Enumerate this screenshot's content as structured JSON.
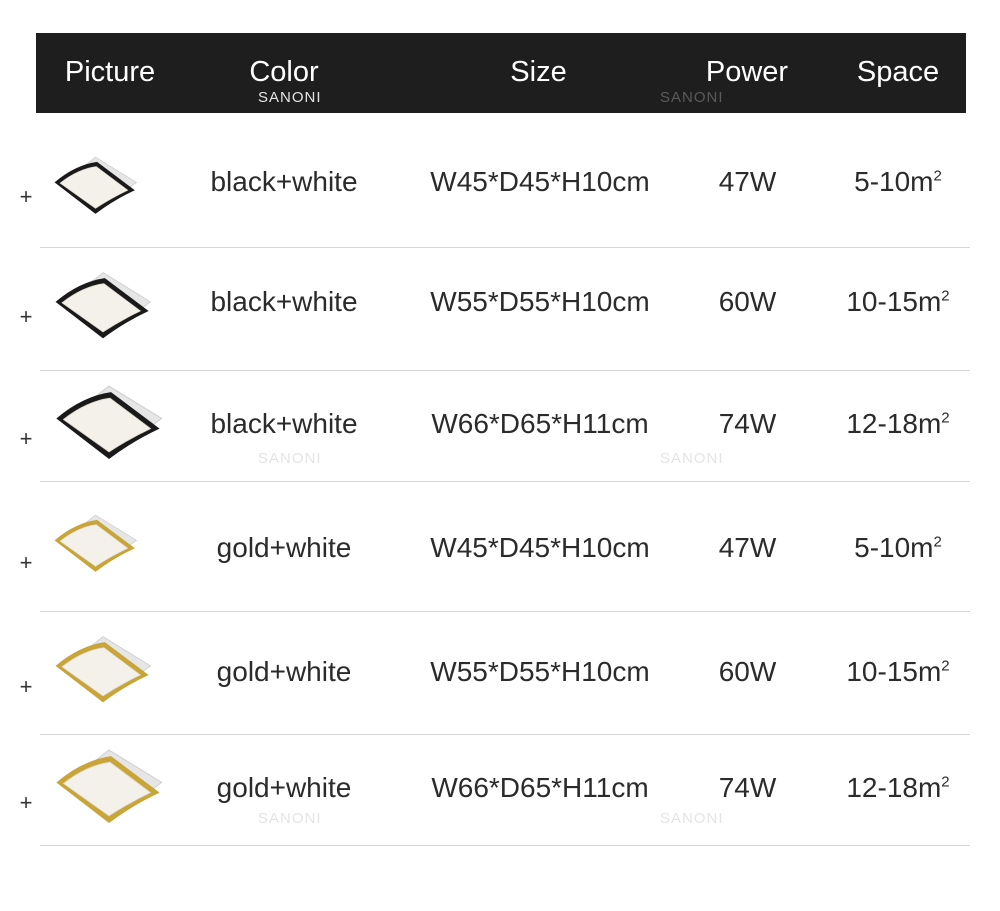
{
  "header": {
    "picture": "Picture",
    "color": "Color",
    "size": "Size",
    "power": "Power",
    "space": "Space"
  },
  "watermark": "SANONI",
  "rows": [
    {
      "plus": "+",
      "color": "black+white",
      "size": "W45*D45*H10cm",
      "power": "47W",
      "space": "5-10m",
      "unit_sup": "2",
      "frame_color": "#1a1a1a",
      "icon": "black-frame-lamp-icon"
    },
    {
      "plus": "+",
      "color": "black+white",
      "size": "W55*D55*H10cm",
      "power": "60W",
      "space": "10-15m",
      "unit_sup": "2",
      "frame_color": "#1a1a1a",
      "icon": "black-frame-lamp-icon"
    },
    {
      "plus": "+",
      "color": "black+white",
      "size": "W66*D65*H11cm",
      "power": "74W",
      "space": "12-18m",
      "unit_sup": "2",
      "frame_color": "#1a1a1a",
      "icon": "black-frame-lamp-icon"
    },
    {
      "plus": "+",
      "color": "gold+white",
      "size": "W45*D45*H10cm",
      "power": "47W",
      "space": "5-10m",
      "unit_sup": "2",
      "frame_color": "#c9a437",
      "icon": "gold-frame-lamp-icon"
    },
    {
      "plus": "+",
      "color": "gold+white",
      "size": "W55*D55*H10cm",
      "power": "60W",
      "space": "10-15m",
      "unit_sup": "2",
      "frame_color": "#c9a437",
      "icon": "gold-frame-lamp-icon"
    },
    {
      "plus": "+",
      "color": "gold+white",
      "size": "W66*D65*H11cm",
      "power": "74W",
      "space": "12-18m",
      "unit_sup": "2",
      "frame_color": "#c9a437",
      "icon": "gold-frame-lamp-icon"
    }
  ]
}
